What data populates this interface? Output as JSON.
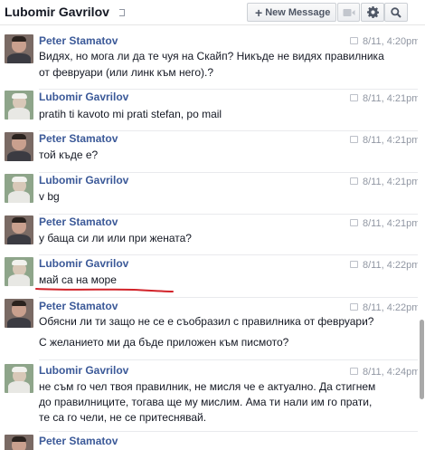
{
  "header": {
    "title": "Lubomir Gavrilov",
    "new_message_label": "New Message"
  },
  "icons": {
    "plus": "plus-icon",
    "video": "video-camera-icon",
    "gear": "gear-icon",
    "search": "search-icon"
  },
  "colors": {
    "name_link": "#3b5998",
    "timestamp": "#9197a3",
    "annotation": "#d2232a"
  },
  "messages": [
    {
      "sender": "Peter Stamatov",
      "time": "8/11, 4:20pm",
      "lines": [
        "Видях, но мога ли да те чуя на Скайп? Никъде не видях правилника",
        "от февруари (или линк към него).?"
      ]
    },
    {
      "sender": "Lubomir Gavrilov",
      "time": "8/11, 4:21pm",
      "lines": [
        "pratih ti kavoto mi prati stefan, po mail"
      ]
    },
    {
      "sender": "Peter Stamatov",
      "time": "8/11, 4:21pm",
      "lines": [
        "той къде е?"
      ]
    },
    {
      "sender": "Lubomir Gavrilov",
      "time": "8/11, 4:21pm",
      "lines": [
        "v bg"
      ]
    },
    {
      "sender": "Peter Stamatov",
      "time": "8/11, 4:21pm",
      "lines": [
        "у баща си ли или при жената?"
      ]
    },
    {
      "sender": "Lubomir Gavrilov",
      "time": "8/11, 4:22pm",
      "lines": [
        "май са на море"
      ]
    },
    {
      "sender": "Peter Stamatov",
      "time": "8/11, 4:22pm",
      "lines": [
        "Обясни ли ти защо не се е съобразил с правилника от февруари?",
        "",
        "С желанието ми да бъде приложен към писмото?"
      ]
    },
    {
      "sender": "Lubomir Gavrilov",
      "time": "8/11, 4:24pm",
      "lines": [
        "не съм го чел твоя правилник, не мисля че е актуално. Да стигнем",
        "до правилниците, тогава ще му мислим. Ама ти нали им го прати,",
        "те са го чели, не се притеснявай."
      ]
    },
    {
      "sender": "Peter Stamatov",
      "time": "",
      "lines": []
    }
  ]
}
